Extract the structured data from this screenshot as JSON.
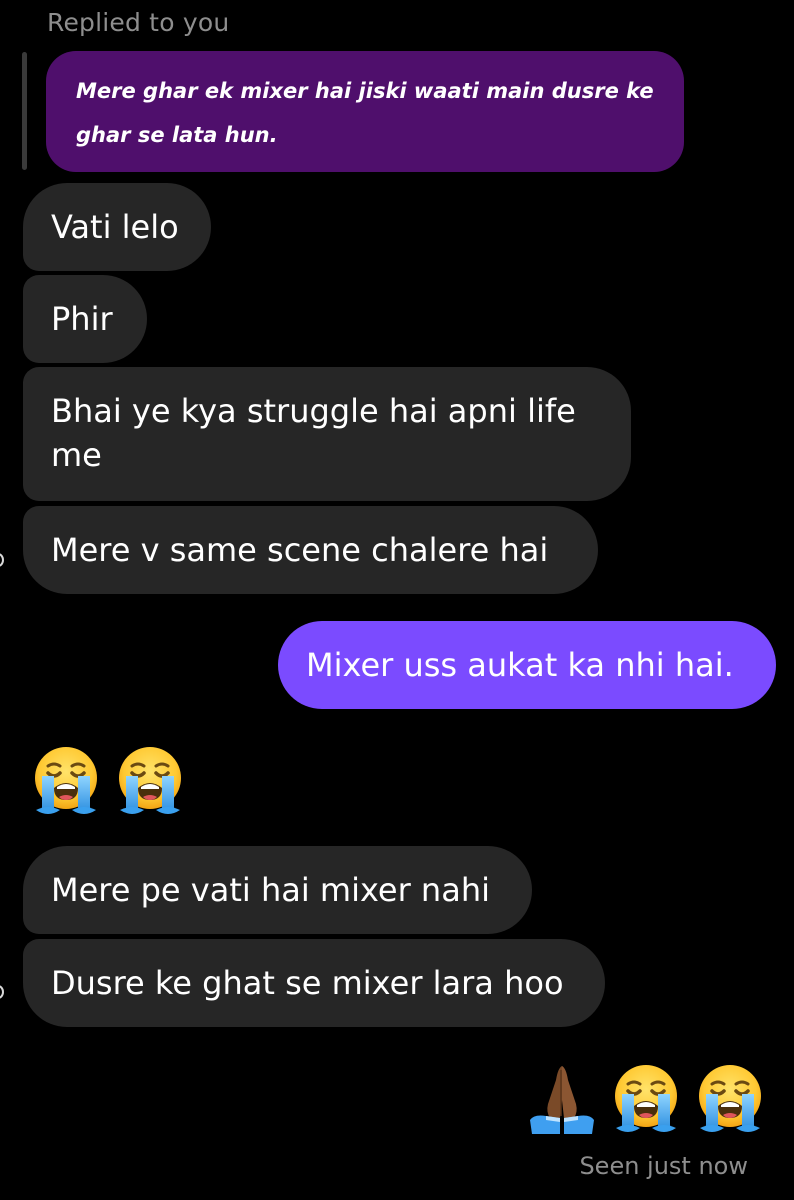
{
  "reply": {
    "label": "Replied to you",
    "quoted_text": "Mere ghar ek mixer hai jiski waati main dusre ke ghar se lata hun."
  },
  "messages_received_1": [
    {
      "text": "Vati lelo"
    },
    {
      "text": "Phir"
    },
    {
      "text": "Bhai ye kya struggle hai apni life me"
    },
    {
      "text": "Mere v same scene chalere hai"
    }
  ],
  "message_sent": {
    "text": "Mixer uss aukat ka nhi hai."
  },
  "emoji_message_received": {
    "emojis": [
      "loudly-crying-face-icon",
      "loudly-crying-face-icon"
    ]
  },
  "messages_received_2": [
    {
      "text": "Mere pe vati hai mixer nahi"
    },
    {
      "text": "Dusre ke ghat se mixer lara hoo"
    }
  ],
  "emoji_message_sent": {
    "emojis": [
      "folded-hands-icon",
      "loudly-crying-face-icon",
      "loudly-crying-face-icon"
    ]
  },
  "status": {
    "seen_text": "Seen just now"
  },
  "colors": {
    "background": "#000000",
    "received_bubble": "#262626",
    "sent_bubble": "#7b4bff",
    "quoted_bubble": "#4f0f6c",
    "muted_text": "#8e8e8e"
  }
}
